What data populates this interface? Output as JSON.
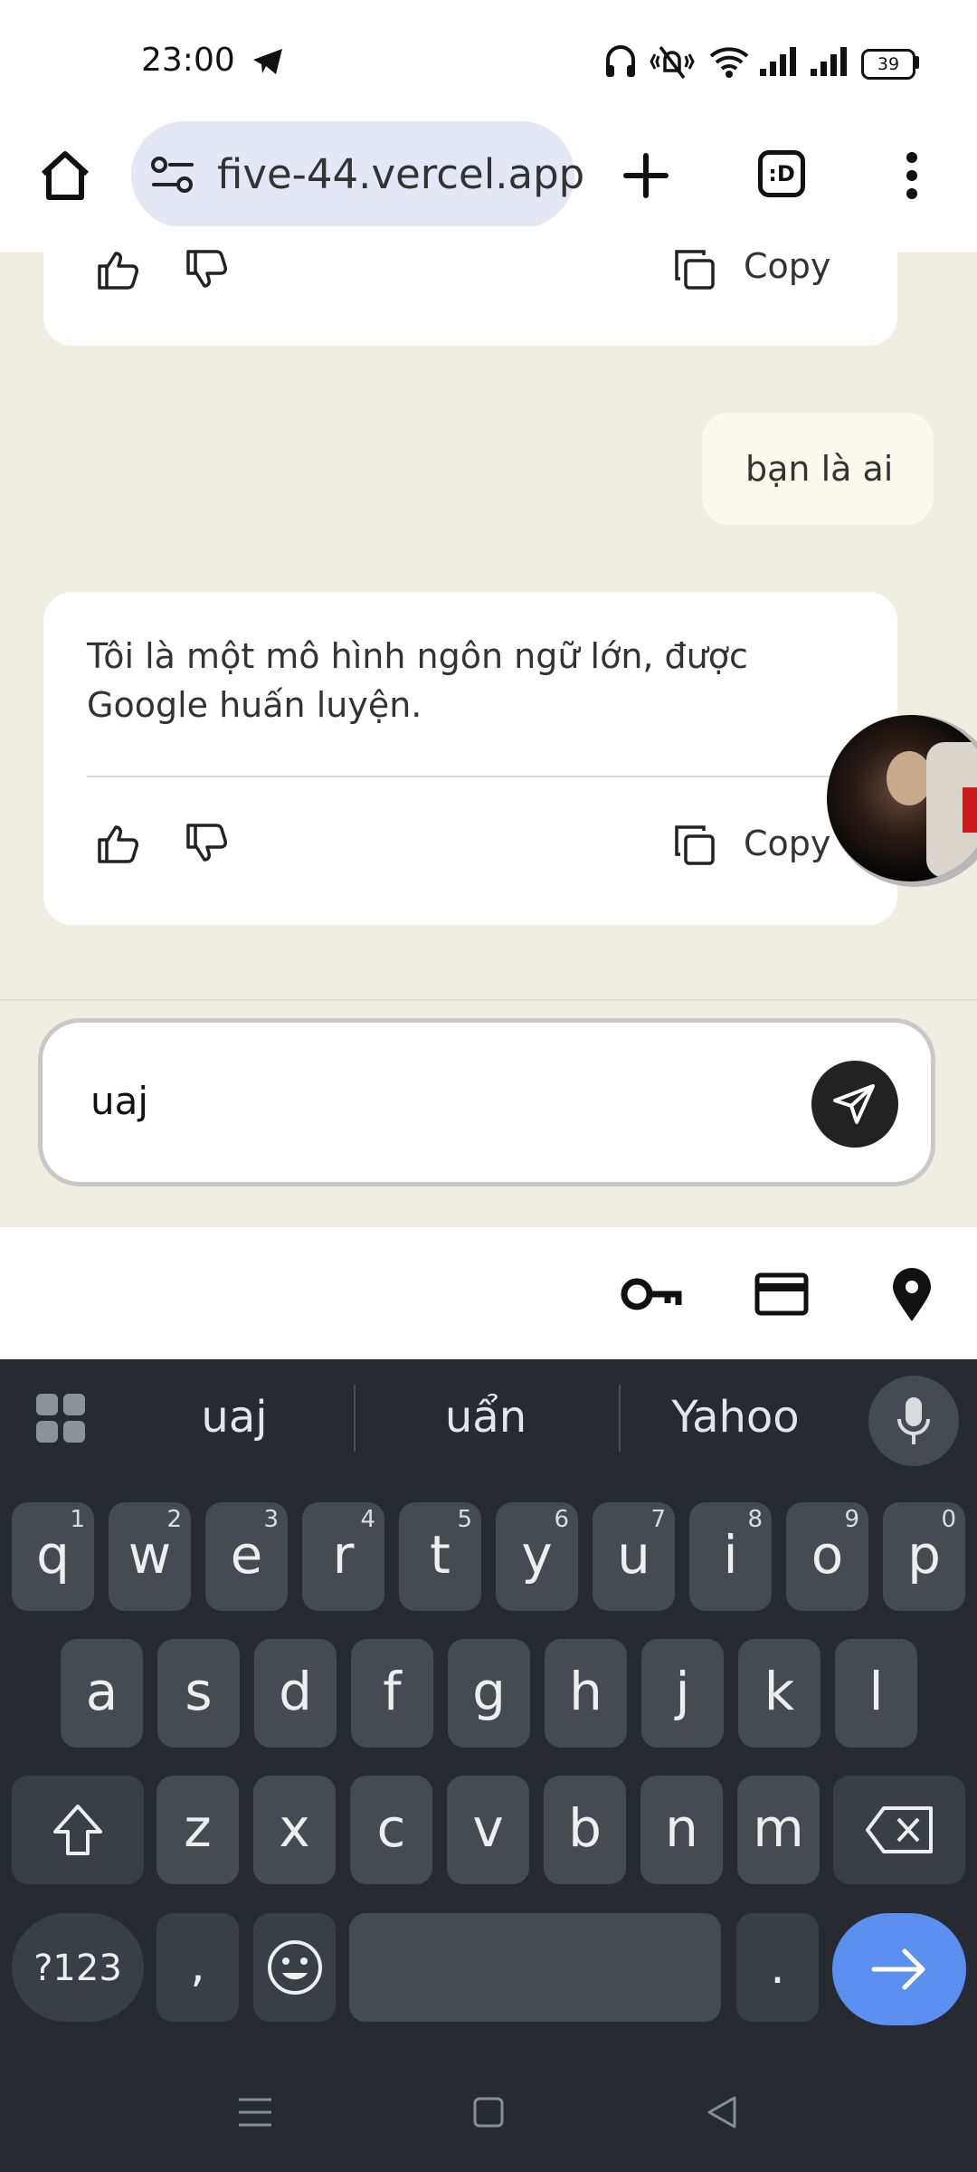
{
  "status_bar": {
    "time": "23:00",
    "battery": "39"
  },
  "browser": {
    "url": "five-44.vercel.app",
    "tabs_label": ":D"
  },
  "chat": {
    "prev_card": {
      "copy_label": "Copy"
    },
    "user_message": "bạn là ai",
    "assistant_message": "Tôi là một mô hình ngôn ngữ lớn, được Google huấn luyện.",
    "assistant_card": {
      "copy_label": "Copy"
    },
    "input_value": "uaj"
  },
  "keyboard": {
    "suggestions": [
      "uaj",
      "uẩn",
      "Yahoo"
    ],
    "row1": [
      {
        "ch": "q",
        "n": "1"
      },
      {
        "ch": "w",
        "n": "2"
      },
      {
        "ch": "e",
        "n": "3"
      },
      {
        "ch": "r",
        "n": "4"
      },
      {
        "ch": "t",
        "n": "5"
      },
      {
        "ch": "y",
        "n": "6"
      },
      {
        "ch": "u",
        "n": "7"
      },
      {
        "ch": "i",
        "n": "8"
      },
      {
        "ch": "o",
        "n": "9"
      },
      {
        "ch": "p",
        "n": "0"
      }
    ],
    "row2": [
      "a",
      "s",
      "d",
      "f",
      "g",
      "h",
      "j",
      "k",
      "l"
    ],
    "row3": [
      "z",
      "x",
      "c",
      "v",
      "b",
      "n",
      "m"
    ],
    "symbols_label": "?123",
    "comma": ",",
    "period": "."
  }
}
